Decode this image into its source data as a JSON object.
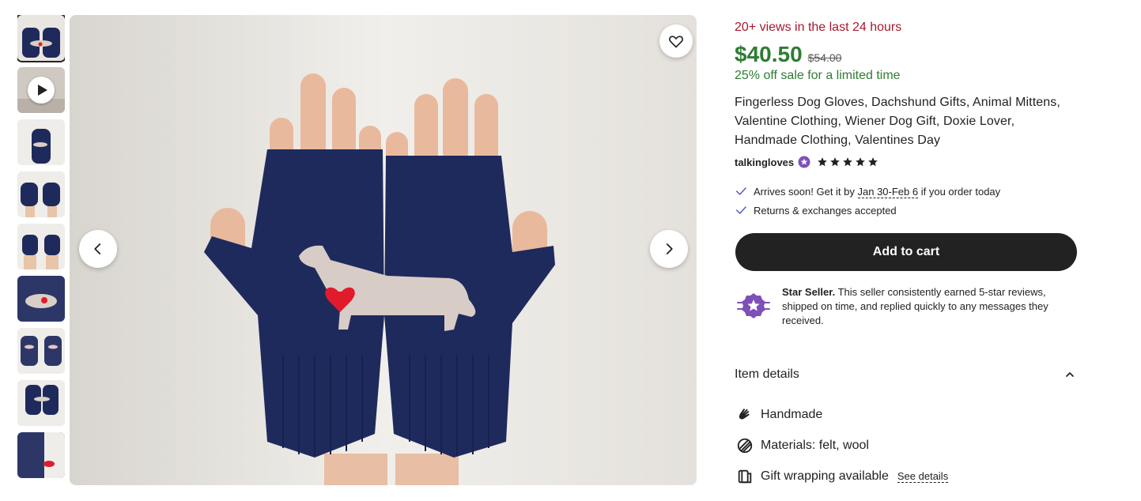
{
  "views_text": "20+ views in the last 24 hours",
  "price": "$40.50",
  "original_price": "$54.00",
  "sale_text": "25% off sale for a limited time",
  "title": "Fingerless Dog Gloves, Dachshund Gifts, Animal Mittens, Valentine Clothing, Wiener Dog Gift, Doxie Lover, Handmade Clothing, Valentines Day",
  "seller": {
    "name": "talkingloves",
    "rating": 5
  },
  "shipping": {
    "prefix": "Arrives soon! Get it by ",
    "dates": "Jan 30-Feb 6",
    "suffix": " if you order today"
  },
  "returns": "Returns & exchanges accepted",
  "add_to_cart": "Add to cart",
  "star_seller": {
    "title": "Star Seller.",
    "text": " This seller consistently earned 5-star reviews, shipped on time, and replied quickly to any messages they received."
  },
  "item_details": {
    "heading": "Item details",
    "handmade": "Handmade",
    "materials": "Materials: felt, wool",
    "gift_wrapping": "Gift wrapping available",
    "see_details": "See details"
  },
  "icons": {
    "favorite": "heart-outline-icon",
    "prev": "chevron-left-icon",
    "next": "chevron-right-icon",
    "check": "check-icon",
    "star_seller": "star-seller-badge-icon",
    "collapse": "chevron-up-icon",
    "handmade": "hand-wave-icon",
    "materials": "materials-icon",
    "gift": "gift-wrap-icon"
  },
  "colors": {
    "views": "#a61a2e",
    "sale_green": "#2e7d32",
    "button_dark": "#222222",
    "star_seller_purple": "#7e4fb8",
    "glove_navy": "#1f2a5c"
  }
}
